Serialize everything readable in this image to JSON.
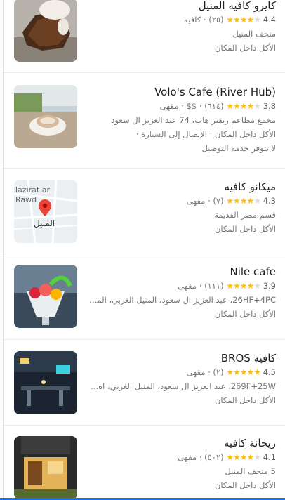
{
  "items": [
    {
      "title": "كايرو كافيه المنيل",
      "rating": "4.4",
      "stars": 4,
      "reviews": "(٢٥)",
      "category": "كافيه",
      "lines": [
        "متحف المنيل",
        "الأكل داخل المكان"
      ]
    },
    {
      "title": "Volo's Cafe (River Hub)",
      "rating": "3.8",
      "stars": 4,
      "reviews": "(٦١٤)",
      "price": "$$",
      "category": "مقهى",
      "lines": [
        "مجمع مطاعم ريفير هاب، 74 عبد العزيز ال سعود",
        "الأكل داخل المكان · الإيصال إلى السيارة ·",
        "لا تتوفر خدمة التوصيل"
      ]
    },
    {
      "title": "ميكانو كافيه",
      "rating": "4.3",
      "stars": 4,
      "reviews": "(٧)",
      "category": "مقهى",
      "lines": [
        "قسم مصر القديمة",
        "الأكل داخل المكان"
      ],
      "map": {
        "label_top": "lazirat ar",
        "label_mid": "Rawd",
        "label_bottom": "المنيل"
      }
    },
    {
      "title": "Nile cafe",
      "rating": "3.9",
      "stars": 4,
      "reviews": "(١١١)",
      "category": "مقهى",
      "lines": [
        "26HF+4PC، عبد العزيز ال سعود، المنيل الغربي، المن...",
        "الأكل داخل المكان"
      ]
    },
    {
      "title": "كافيه BROS",
      "rating": "4.5",
      "stars": 5,
      "reviews": "(٢)",
      "category": "مقهى",
      "lines": [
        "269F+25W، عبد العزيز ال سعود، المنيل الغربي، اه...",
        "الأكل داخل المكان"
      ]
    },
    {
      "title": "ريحانة كافيه",
      "rating": "4.1",
      "stars": 4,
      "reviews": "(٥٠٢)",
      "category": "مقهى",
      "lines": [
        "5 متحف المنيل",
        "الأكل داخل المكان"
      ]
    }
  ],
  "separator": "·",
  "colors": {
    "star": "#fbbc04",
    "accent": "#1a73e8"
  }
}
